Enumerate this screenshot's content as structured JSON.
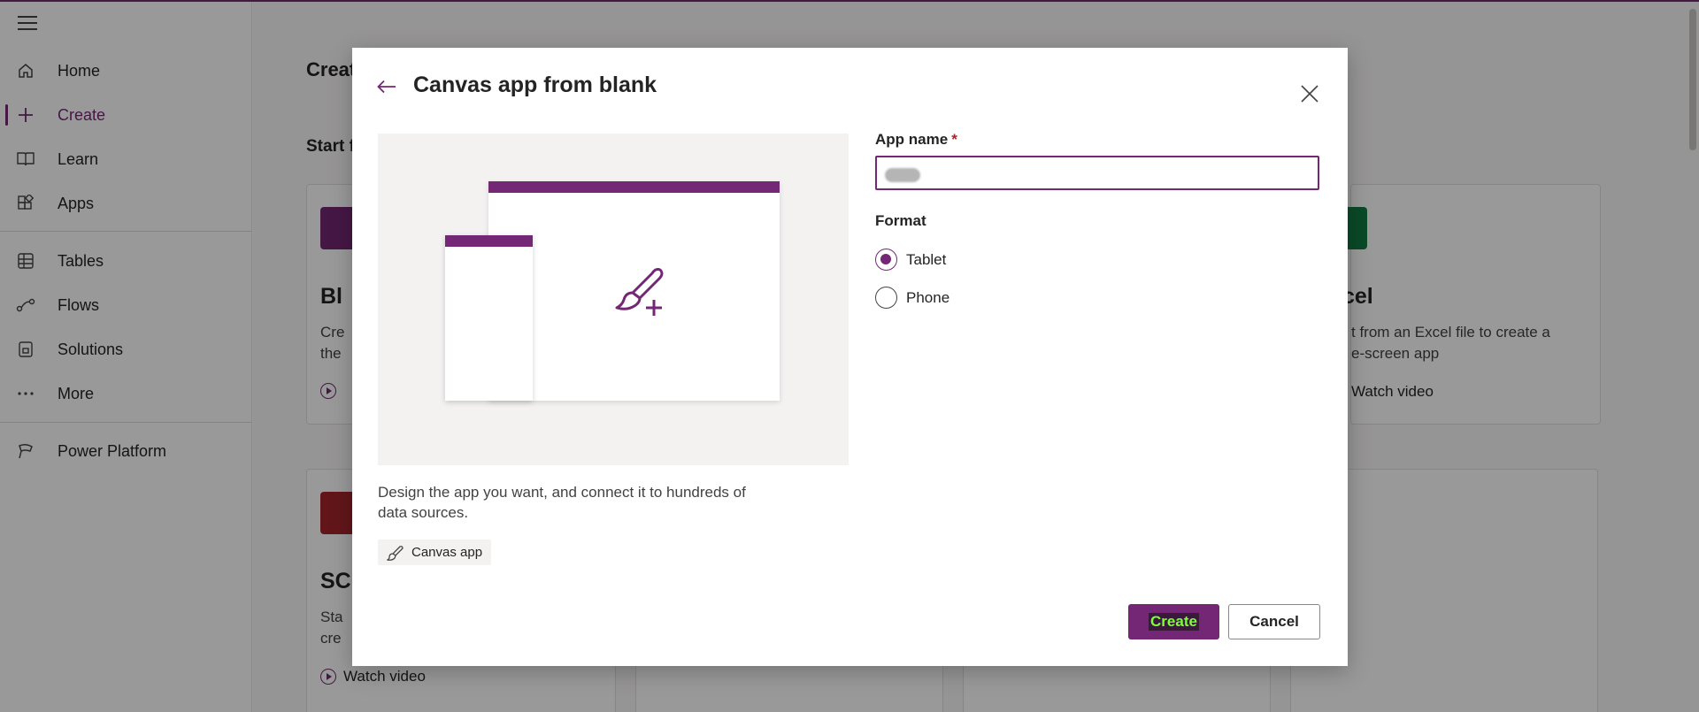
{
  "nav": {
    "items": [
      {
        "label": "Home",
        "icon": "home-icon"
      },
      {
        "label": "Create",
        "icon": "plus-icon",
        "active": true
      },
      {
        "label": "Learn",
        "icon": "book-icon"
      },
      {
        "label": "Apps",
        "icon": "apps-icon"
      },
      {
        "label": "Tables",
        "icon": "table-icon"
      },
      {
        "label": "Flows",
        "icon": "flow-icon"
      },
      {
        "label": "Solutions",
        "icon": "solutions-icon"
      },
      {
        "label": "More",
        "icon": "more-icon"
      },
      {
        "label": "Power Platform",
        "icon": "power-platform-icon"
      }
    ]
  },
  "background": {
    "title": "Creat",
    "subtitle": "Start f",
    "cards": [
      {
        "title": "Bl",
        "desc_line1": "Cre",
        "desc_line2": "the"
      },
      {
        "title": "cel",
        "desc_line1": "t from an Excel file to create a",
        "desc_line2": "e-screen app",
        "watch": "Watch video"
      },
      {
        "title": "SC",
        "desc_line1": "Sta",
        "desc_line2": "cre",
        "watch": "Watch video"
      }
    ]
  },
  "dialog": {
    "title": "Canvas app from blank",
    "description": "Design the app you want, and connect it to hundreds of data sources.",
    "tag": "Canvas app",
    "app_name_label": "App name",
    "required_marker": "*",
    "app_name_value": "",
    "format_label": "Format",
    "formats": [
      {
        "label": "Tablet",
        "checked": true
      },
      {
        "label": "Phone",
        "checked": false
      }
    ],
    "create_label": "Create",
    "cancel_label": "Cancel"
  },
  "colors": {
    "accent": "#742774",
    "required": "#a4262c",
    "overlay": "rgba(0,0,0,0.4)"
  }
}
